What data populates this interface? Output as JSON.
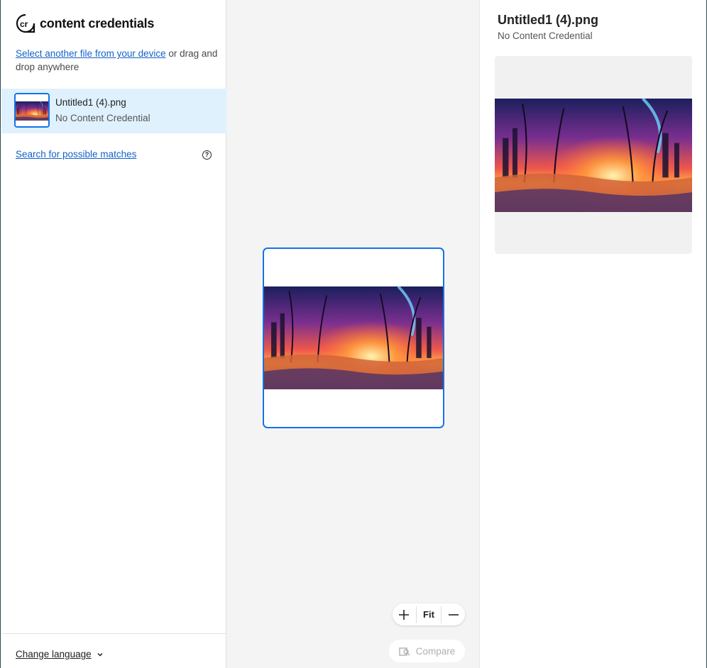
{
  "brand": {
    "name": "content credentials",
    "logo_letters": "cr"
  },
  "upload": {
    "link_text": "Select another file from your device",
    "rest_text": " or drag and drop anywhere"
  },
  "file_list": [
    {
      "name": "Untitled1 (4).png",
      "status": "No Content Credential",
      "selected": true
    }
  ],
  "search": {
    "label": "Search for possible matches",
    "help_icon": "help-circle-icon",
    "help_glyph": "?"
  },
  "footer": {
    "change_language": "Change language"
  },
  "zoom": {
    "zoom_in_icon": "plus-icon",
    "fit_label": "Fit",
    "zoom_out_icon": "minus-icon"
  },
  "compare": {
    "label": "Compare",
    "icon": "compare-icon"
  },
  "details": {
    "title": "Untitled1 (4).png",
    "status": "No Content Credential"
  },
  "colors": {
    "accent": "#1473e6",
    "link": "#1462c8",
    "selected_bg": "#dff1fd",
    "canvas_bg": "#f4f4f4"
  }
}
